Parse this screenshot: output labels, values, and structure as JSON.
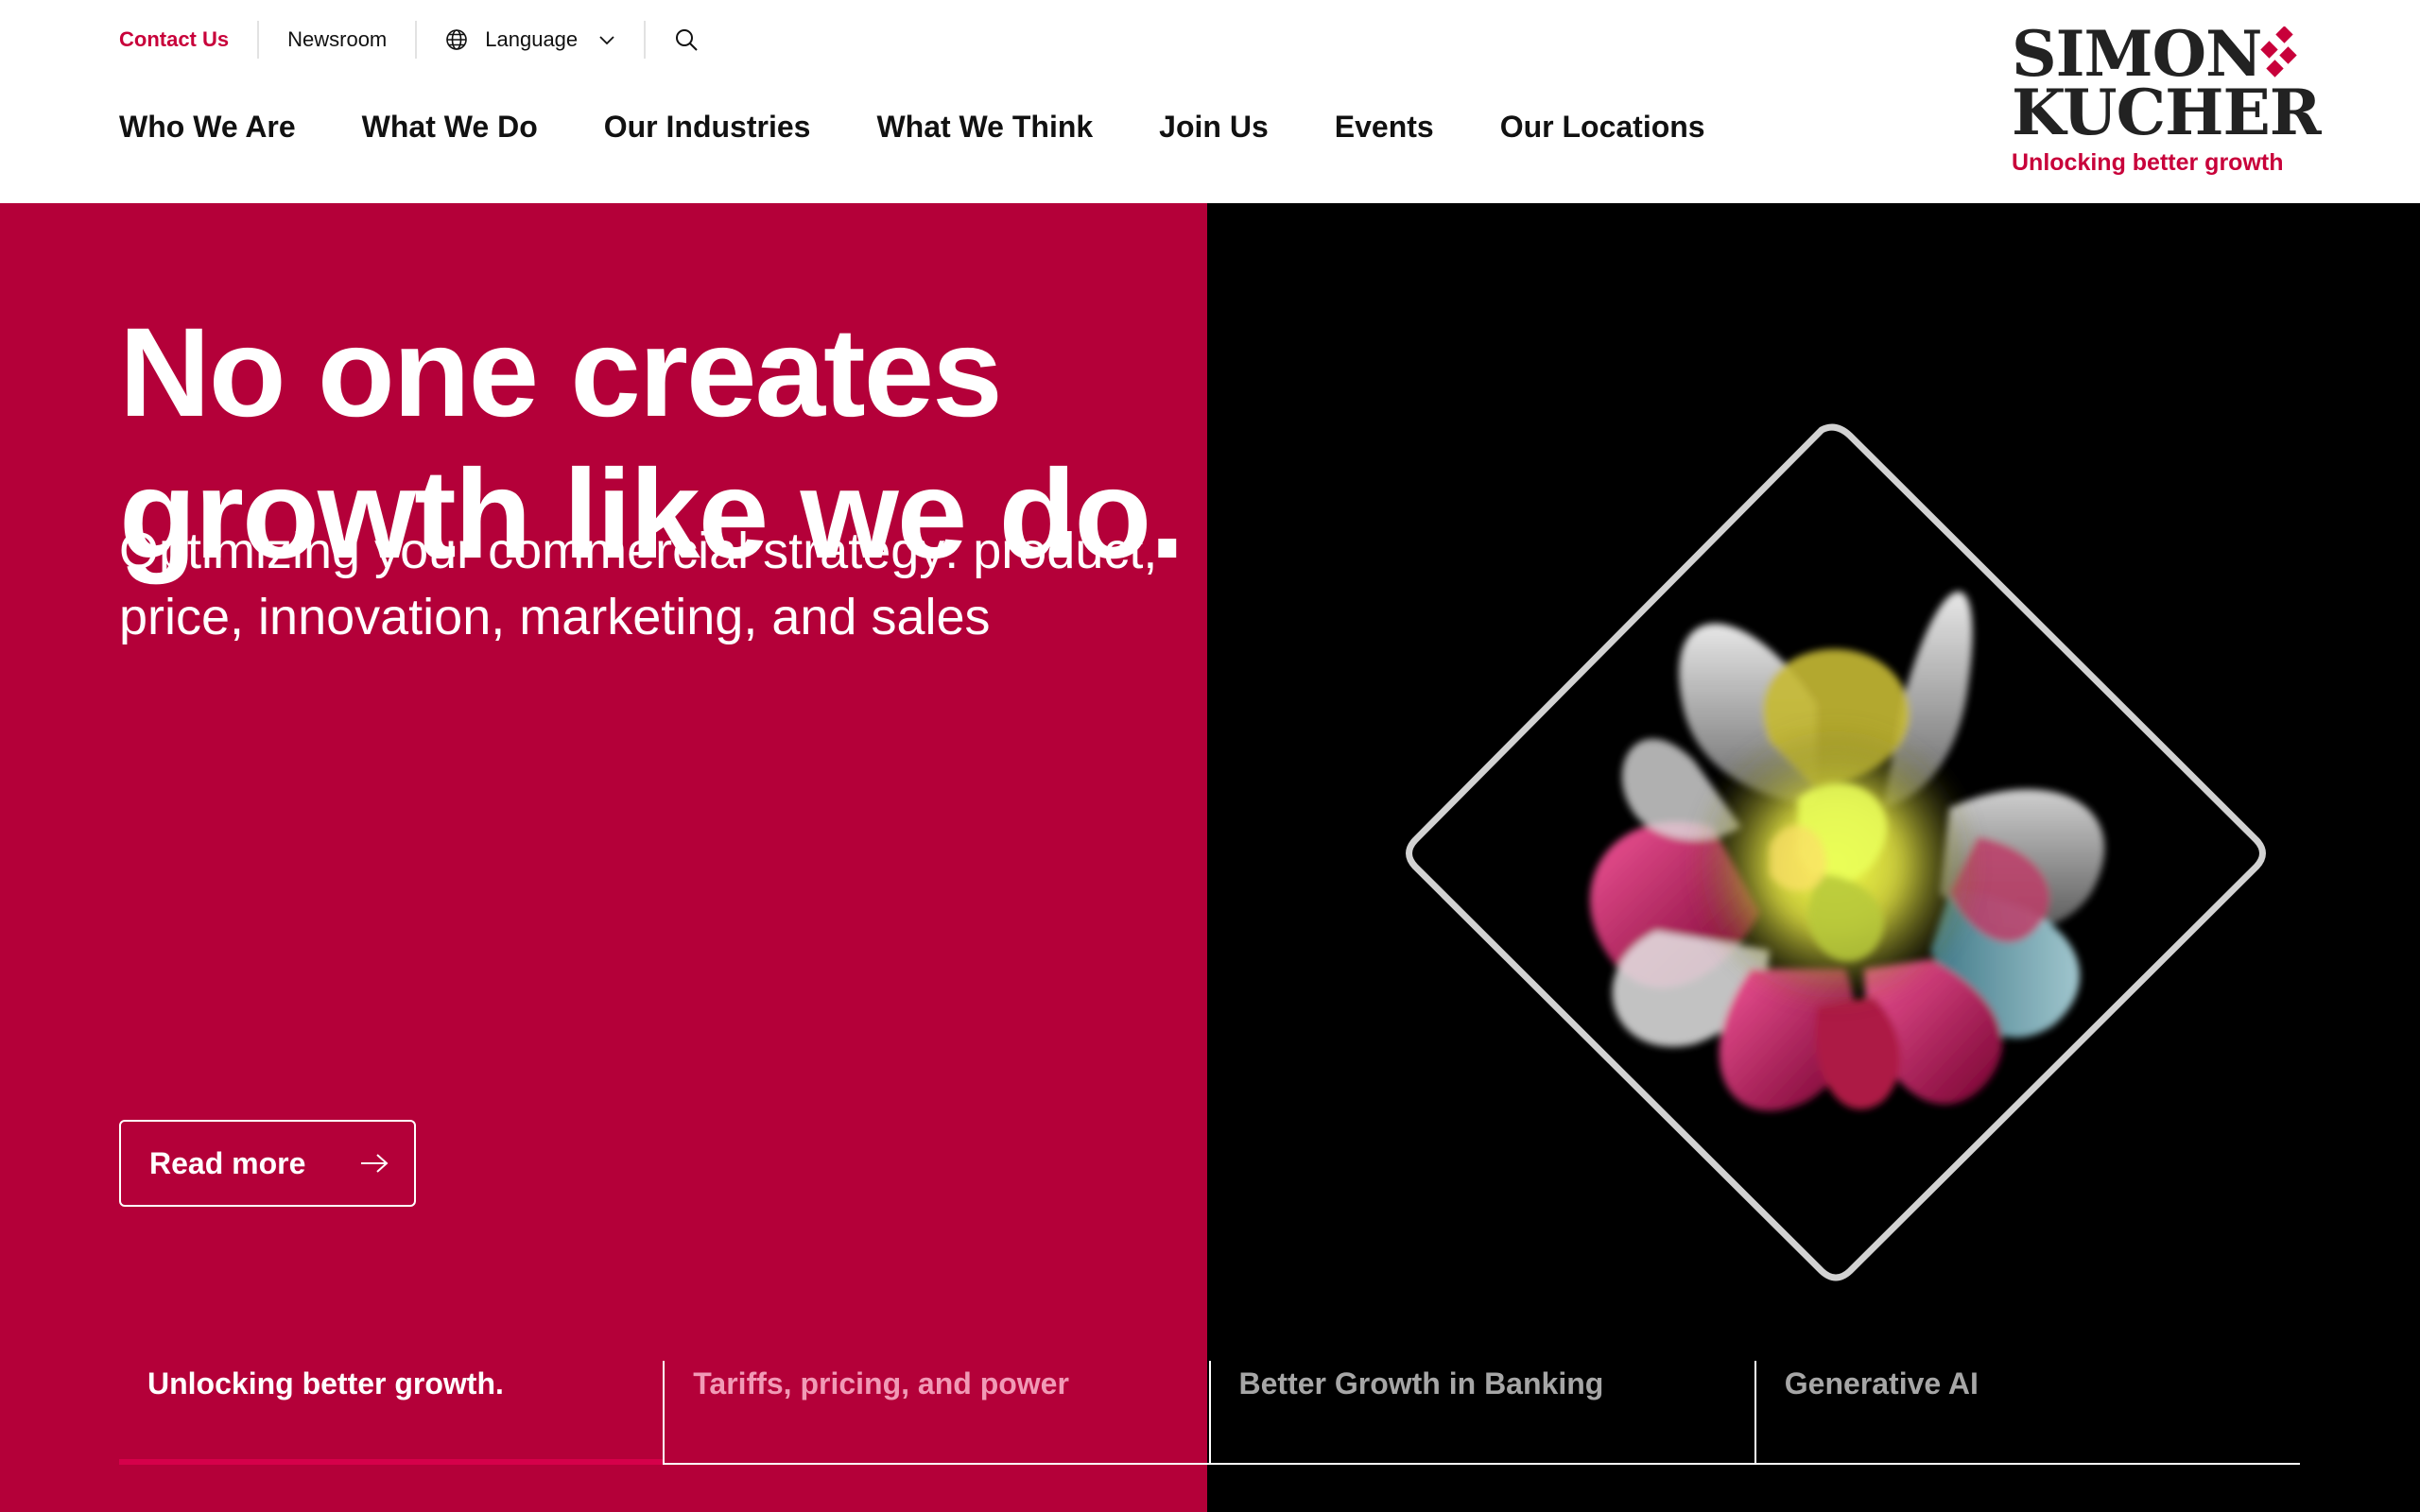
{
  "utility": {
    "contact": "Contact Us",
    "newsroom": "Newsroom",
    "language": "Language"
  },
  "nav": [
    {
      "label": "Who We Are"
    },
    {
      "label": "What We Do"
    },
    {
      "label": "Our Industries"
    },
    {
      "label": "What We Think"
    },
    {
      "label": "Join Us"
    },
    {
      "label": "Events"
    },
    {
      "label": "Our Locations"
    }
  ],
  "logo": {
    "line1": "SIMON",
    "line2": "KUCHER",
    "tagline": "Unlocking better growth"
  },
  "hero": {
    "headline_line1": "No one creates",
    "headline_line2": "growth like we do.",
    "subhead": "Optimizing your commercial strategy: product, price, innovation, marketing, and sales",
    "cta": "Read more"
  },
  "tabs": [
    {
      "label": "Unlocking better growth.",
      "state": "active",
      "progress": 1.0
    },
    {
      "label": "Tariffs, pricing, and power",
      "state": "next"
    },
    {
      "label": "Better Growth in Banking",
      "state": "inactive"
    },
    {
      "label": "Generative AI",
      "state": "inactive"
    }
  ],
  "colors": {
    "brand_red": "#b40039",
    "accent_red": "#c8003a",
    "black": "#000000"
  },
  "icons": [
    "globe-icon",
    "chevron-down-icon",
    "search-icon",
    "arrow-right-icon",
    "logo-diamond-icon"
  ]
}
